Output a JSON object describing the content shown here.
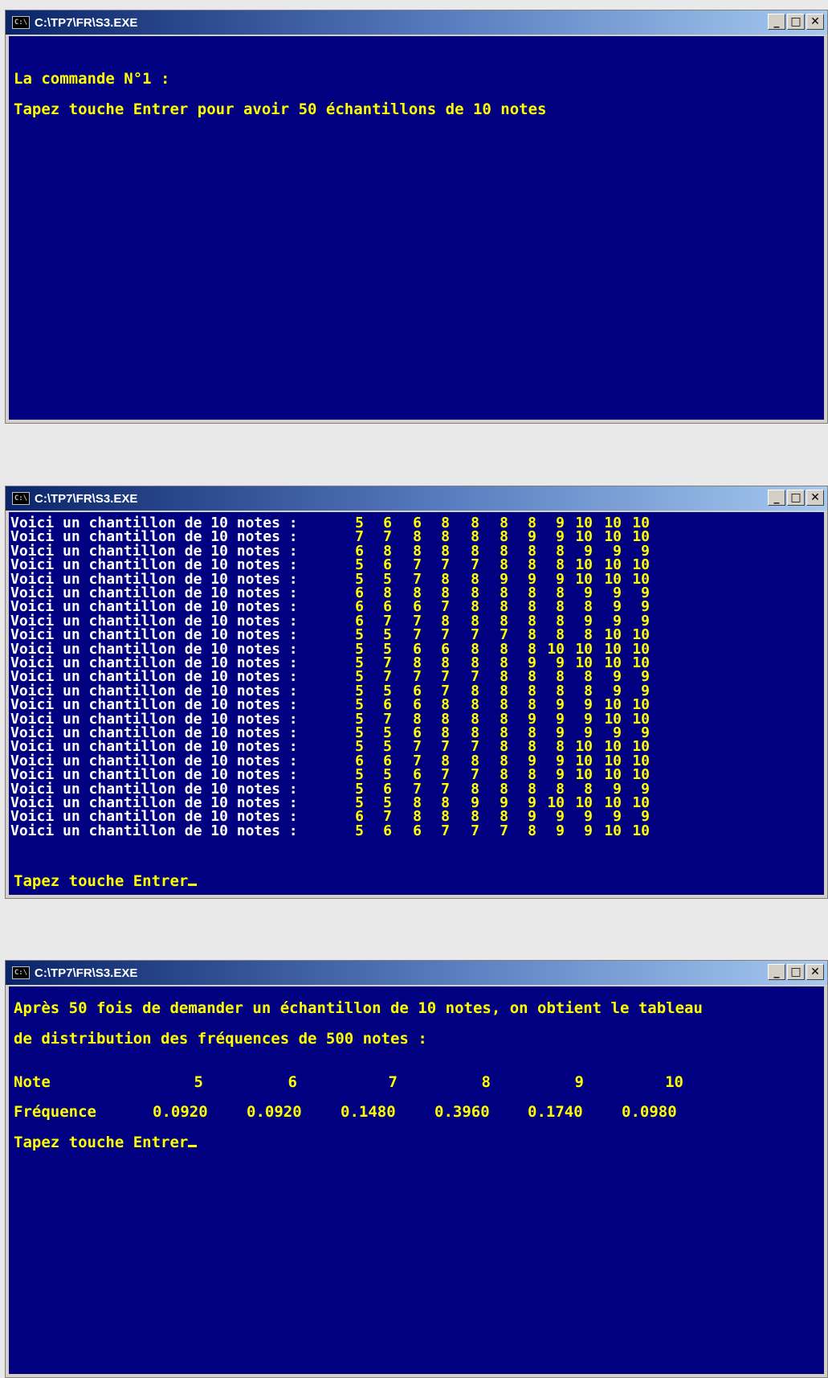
{
  "window_title": "C:\\TP7\\FR\\S3.EXE",
  "app_icon": "C:\\",
  "window_buttons": {
    "minimize": "_",
    "maximize": "□",
    "close": "✕"
  },
  "screen1": {
    "line1": "La commande N°1 :",
    "line2": "Tapez touche Entrer pour avoir 50 échantillons de 10 notes"
  },
  "screen2": {
    "row_label": "Voici un chantillon de 10 notes :",
    "samples": [
      [
        5,
        6,
        6,
        8,
        8,
        8,
        8,
        9,
        10,
        10,
        10
      ],
      [
        7,
        7,
        8,
        8,
        8,
        8,
        9,
        9,
        10,
        10,
        10
      ],
      [
        6,
        8,
        8,
        8,
        8,
        8,
        8,
        8,
        9,
        9,
        9
      ],
      [
        5,
        6,
        7,
        7,
        7,
        8,
        8,
        8,
        10,
        10,
        10
      ],
      [
        5,
        5,
        7,
        8,
        8,
        9,
        9,
        9,
        10,
        10,
        10
      ],
      [
        6,
        8,
        8,
        8,
        8,
        8,
        8,
        8,
        9,
        9,
        9
      ],
      [
        6,
        6,
        6,
        7,
        8,
        8,
        8,
        8,
        8,
        9,
        9
      ],
      [
        6,
        7,
        7,
        8,
        8,
        8,
        8,
        8,
        9,
        9,
        9
      ],
      [
        5,
        5,
        7,
        7,
        7,
        7,
        8,
        8,
        8,
        10,
        10
      ],
      [
        5,
        5,
        6,
        6,
        8,
        8,
        8,
        10,
        10,
        10,
        10
      ],
      [
        5,
        7,
        8,
        8,
        8,
        8,
        9,
        9,
        10,
        10,
        10
      ],
      [
        5,
        7,
        7,
        7,
        7,
        8,
        8,
        8,
        8,
        9,
        9
      ],
      [
        5,
        5,
        6,
        7,
        8,
        8,
        8,
        8,
        8,
        9,
        9
      ],
      [
        5,
        6,
        6,
        8,
        8,
        8,
        8,
        9,
        9,
        10,
        10
      ],
      [
        5,
        7,
        8,
        8,
        8,
        8,
        9,
        9,
        9,
        10,
        10
      ],
      [
        5,
        5,
        6,
        8,
        8,
        8,
        8,
        9,
        9,
        9,
        9
      ],
      [
        5,
        5,
        7,
        7,
        7,
        8,
        8,
        8,
        10,
        10,
        10
      ],
      [
        6,
        6,
        7,
        8,
        8,
        8,
        9,
        9,
        10,
        10,
        10
      ],
      [
        5,
        5,
        6,
        7,
        7,
        8,
        8,
        9,
        10,
        10,
        10
      ],
      [
        5,
        6,
        7,
        7,
        8,
        8,
        8,
        8,
        8,
        9,
        9
      ],
      [
        5,
        5,
        8,
        8,
        9,
        9,
        9,
        10,
        10,
        10,
        10
      ],
      [
        6,
        7,
        8,
        8,
        8,
        8,
        9,
        9,
        9,
        9,
        9
      ],
      [
        5,
        6,
        6,
        7,
        7,
        7,
        8,
        9,
        9,
        10,
        10
      ]
    ],
    "prompt": "Tapez touche Entrer"
  },
  "screen3": {
    "line1": "Après 50 fois de demander un échantillon de 10 notes, on obtient le tableau",
    "line2": "de distribution des fréquences de 500 notes :",
    "note_label": "Note",
    "freq_label": "Fréquence",
    "notes": [
      "5",
      "6",
      "7",
      "8",
      "9",
      "10"
    ],
    "frequences": [
      "0.0920",
      "0.0920",
      "0.1480",
      "0.3960",
      "0.1740",
      "0.0980"
    ],
    "prompt": "Tapez touche Entrer"
  }
}
